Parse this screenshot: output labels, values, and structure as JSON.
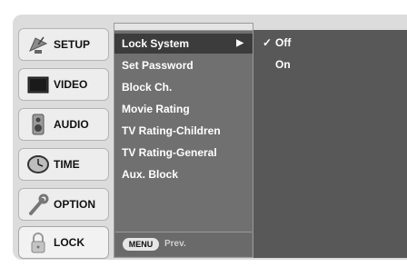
{
  "sidebar": {
    "items": [
      {
        "label": "SETUP",
        "icon": "satellite-dish-icon"
      },
      {
        "label": "VIDEO",
        "icon": "tv-screen-icon"
      },
      {
        "label": "AUDIO",
        "icon": "speaker-icon"
      },
      {
        "label": "TIME",
        "icon": "clock-icon"
      },
      {
        "label": "OPTION",
        "icon": "wrench-icon"
      },
      {
        "label": "LOCK",
        "icon": "padlock-icon"
      }
    ],
    "selected": "LOCK"
  },
  "menu": {
    "items": [
      {
        "label": "Lock System",
        "arrow": "▶"
      },
      {
        "label": "Set Password"
      },
      {
        "label": "Block Ch."
      },
      {
        "label": "Movie Rating"
      },
      {
        "label": "TV Rating-Children"
      },
      {
        "label": "TV Rating-General"
      },
      {
        "label": "Aux. Block"
      }
    ],
    "footer": {
      "button": "MENU",
      "text": "Prev."
    }
  },
  "options": {
    "items": [
      {
        "label": "Off",
        "check": "✓"
      },
      {
        "label": "On",
        "check": ""
      }
    ]
  },
  "colors": {
    "panel_bg": "#dcdcdc",
    "menu_bg": "#707070",
    "menu_active": "#3c3c3c",
    "options_bg": "#585858"
  }
}
